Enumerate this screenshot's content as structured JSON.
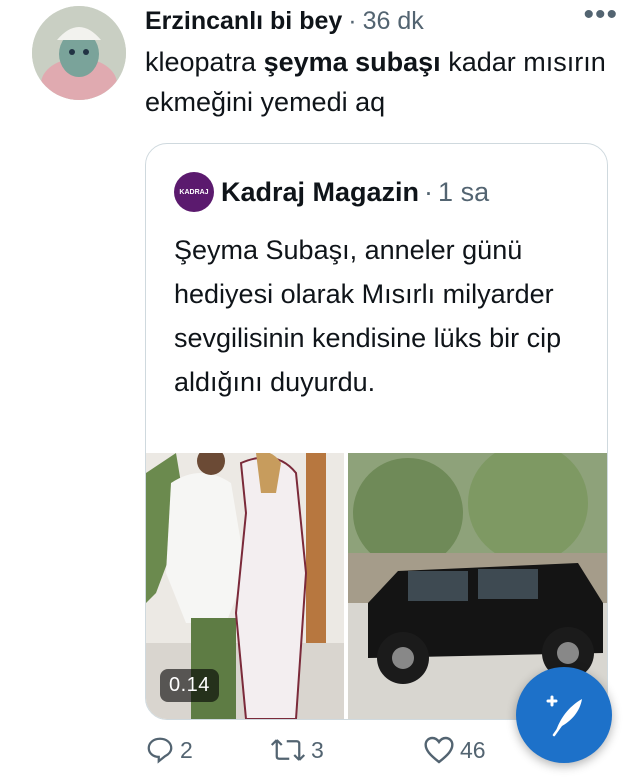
{
  "tweet": {
    "author": "Erzincanlı bi bey",
    "separator": "·",
    "time": "36 dk",
    "more": "•••",
    "text_part1": "kleopatra ",
    "text_bold": "şeyma subaşı",
    "text_part2": " kadar mısırın ekmeğini yemedi aq"
  },
  "quote": {
    "avatar_text": "KADRAJ",
    "author": "Kadraj Magazin",
    "separator": "·",
    "time": "1 sa",
    "text": "Şeyma Subaşı, anneler günü hediyesi olarak Mısırlı milyarder sevgilisinin kendisine lüks bir cip aldığını duyurdu.",
    "media_duration": "0.14"
  },
  "actions": {
    "reply_count": "2",
    "retweet_count": "3",
    "like_count": "46"
  },
  "colors": {
    "accent": "#1d71c9",
    "secondary_text": "#536471",
    "border": "#cfd9de"
  }
}
